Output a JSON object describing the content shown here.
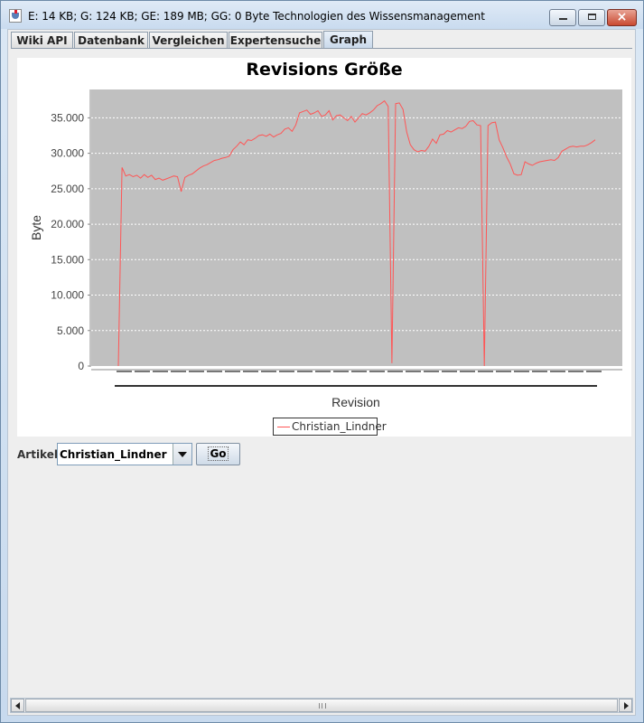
{
  "window": {
    "title": "E: 14 KB; G: 124 KB; GE: 189 MB; GG: 0 Byte Technologien des Wissensmanagement",
    "icon": "java-cup-icon",
    "close_label": "×"
  },
  "tabs": [
    {
      "label": "Wiki API"
    },
    {
      "label": "Datenbank"
    },
    {
      "label": "Vergleichen"
    },
    {
      "label": "Expertensuche"
    },
    {
      "label": "Graph",
      "selected": true
    }
  ],
  "controls": {
    "artikel_label": "Artikel:",
    "artikel_value": "Christian_Lindner",
    "go_label": "Go"
  },
  "colors": {
    "series_line": "#ff5555",
    "plot_background": "#c0c0c0"
  },
  "chart_data": {
    "type": "line",
    "title": "Revisions Größe",
    "xlabel": "Revision",
    "ylabel": "Byte",
    "ylim": [
      0,
      39000
    ],
    "yticks": [
      "0",
      "5.000",
      "10.000",
      "15.000",
      "20.000",
      "25.000",
      "30.000",
      "35.000"
    ],
    "ytick_values": [
      0,
      5000,
      10000,
      15000,
      20000,
      25000,
      30000,
      35000
    ],
    "grid": true,
    "legend_position": "bottom-center",
    "series": [
      {
        "name": "Christian_Lindner",
        "values": [
          0,
          28000,
          26800,
          27000,
          26700,
          26900,
          26500,
          27000,
          26600,
          26900,
          26300,
          26500,
          26200,
          26400,
          26600,
          26800,
          26700,
          24600,
          26600,
          26900,
          27100,
          27500,
          27900,
          28200,
          28400,
          28700,
          29000,
          29100,
          29300,
          29400,
          29600,
          30500,
          31000,
          31600,
          31200,
          31900,
          31800,
          32100,
          32500,
          32600,
          32400,
          32700,
          32300,
          32600,
          32800,
          33400,
          33600,
          33100,
          34000,
          35700,
          35900,
          36100,
          35500,
          35700,
          36000,
          35200,
          35400,
          36000,
          34700,
          35300,
          35400,
          35000,
          34600,
          35200,
          34400,
          35000,
          35600,
          35400,
          35700,
          36100,
          36700,
          37000,
          37400,
          36600,
          400,
          37000,
          37100,
          36200,
          33000,
          31200,
          30500,
          30200,
          30400,
          30300,
          31000,
          32000,
          31400,
          32600,
          32700,
          33200,
          33000,
          33300,
          33600,
          33500,
          33800,
          34500,
          34600,
          34000,
          33900,
          0,
          33900,
          34300,
          34400,
          31900,
          30800,
          29500,
          28500,
          27100,
          26900,
          27000,
          28800,
          28500,
          28300,
          28600,
          28800,
          28900,
          29000,
          29100,
          29000,
          29400,
          30300,
          30600,
          30900,
          31000,
          30900,
          31000,
          31000,
          31200,
          31500,
          31900
        ]
      }
    ]
  }
}
